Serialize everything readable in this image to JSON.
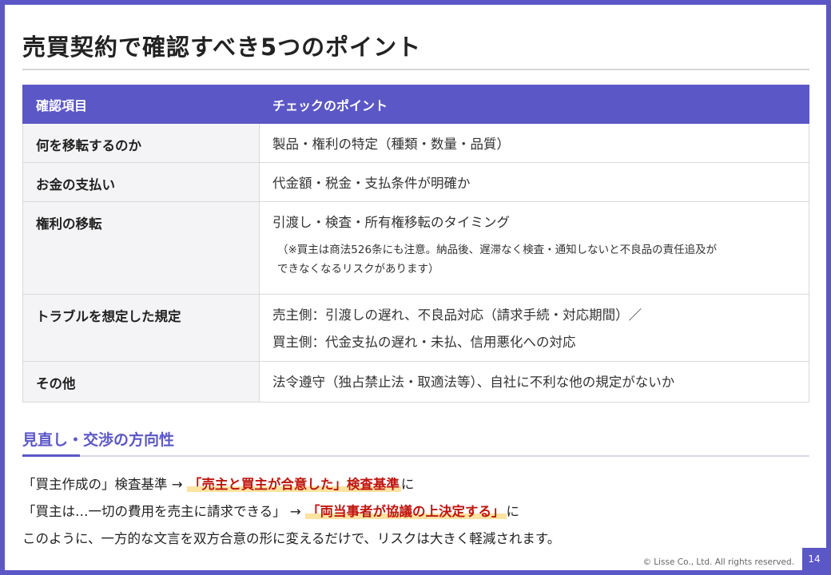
{
  "slide": {
    "title": "売買契約で確認すべき5つのポイント",
    "page_number": "14",
    "copyright": "© Lisse Co., Ltd. All rights reserved.",
    "accent_color": "#5b57c6",
    "highlight_text_color": "#c0150f"
  },
  "table": {
    "headers": [
      "確認項目",
      "チェックのポイント"
    ],
    "rows": [
      {
        "item": "何を移転するのか",
        "point": "製品・権利の特定（種類・数量・品質）"
      },
      {
        "item": "お金の支払い",
        "point": "代金額・税金・支払条件が明確か"
      },
      {
        "item": "権利の移転",
        "point": "引渡し・検査・所有権移転のタイミング",
        "note_1": "（※買主は商法526条にも注意。納品後、遅滞なく検査・通知しないと不良品の責任追及が",
        "note_2": "できなくなるリスクがあります）"
      },
      {
        "item": "トラブルを想定した規定",
        "point": "売主側：引渡しの遅れ、不良品対応（請求手続・対応期間）／",
        "point_2": "買主側：代金支払の遅れ・未払、信用悪化への対応"
      },
      {
        "item": "その他",
        "point": "法令遵守（独占禁止法・取適法等）、自社に不利な他の規定がないか"
      }
    ]
  },
  "review": {
    "heading": "見直し・交渉の方向性",
    "line1_before": "「買主作成の」検査基準 → ",
    "line1_highlight": "「売主と買主が合意した」検査基準",
    "line1_after": "に",
    "line2_before": "「買主は…一切の費用を売主に請求できる」 → ",
    "line2_highlight": "「両当事者が協議の上決定する」",
    "line2_after": "に",
    "line3": "このように、一方的な文言を双方合意の形に変えるだけで、リスクは大きく軽減されます。"
  }
}
